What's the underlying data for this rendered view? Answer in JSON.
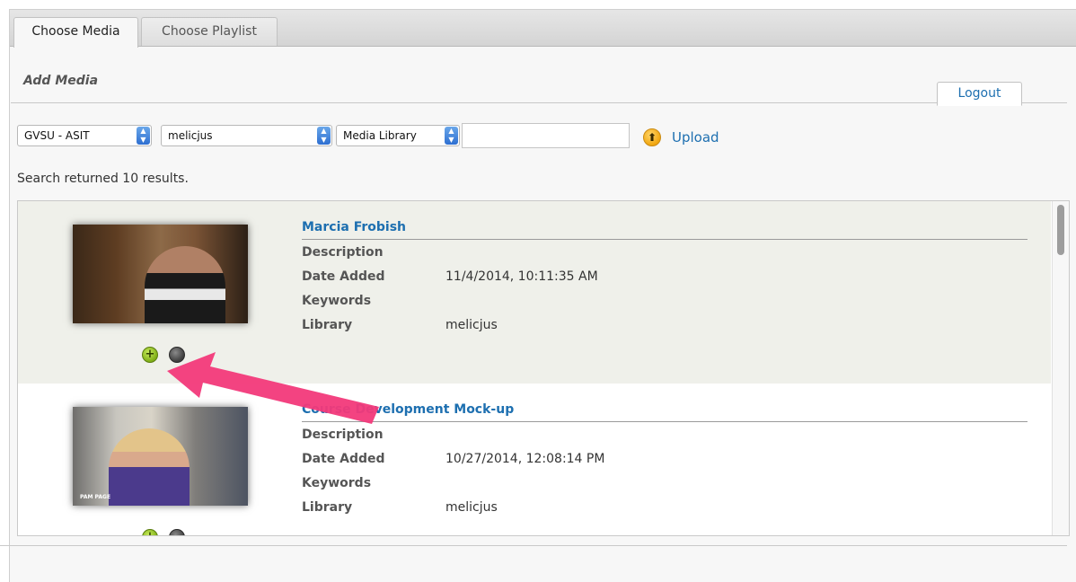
{
  "tabs": [
    {
      "label": "Choose Media"
    },
    {
      "label": "Choose Playlist"
    }
  ],
  "section_title": "Add Media",
  "logout_label": "Logout",
  "filters": {
    "institution": "GVSU - ASIT",
    "user": "melicjus",
    "source": "Media Library",
    "search_value": ""
  },
  "upload_label": "Upload",
  "results_text": "Search returned 10 results.",
  "field_labels": {
    "description": "Description",
    "date_added": "Date Added",
    "keywords": "Keywords",
    "library": "Library"
  },
  "items": [
    {
      "title": "Marcia Frobish",
      "description": "",
      "date_added": "11/4/2014, 10:11:35 AM",
      "keywords": "",
      "library": "melicjus"
    },
    {
      "title": "Course Development Mock-up",
      "description": "",
      "date_added": "10/27/2014, 12:08:14 PM",
      "keywords": "",
      "library": "melicjus",
      "thumbnail_caption": "PAM PAGE"
    }
  ],
  "colors": {
    "link": "#1d6fb0",
    "selected_row": "#eff0ea",
    "annotation_arrow": "#f2397a",
    "add_button": "#7fae17"
  },
  "icons": {
    "upload": "upload-arrow-icon",
    "add": "plus-icon",
    "info": "info-icon",
    "select_arrow": "select-arrows-icon"
  }
}
